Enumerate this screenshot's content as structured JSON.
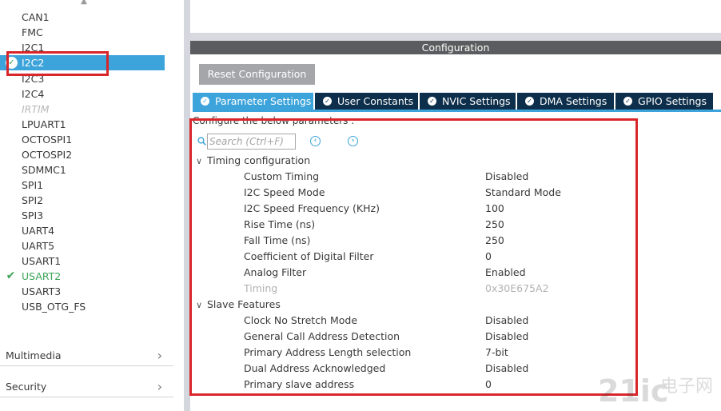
{
  "sidebar": {
    "items": [
      {
        "label": "CAN1",
        "state": "normal"
      },
      {
        "label": "FMC",
        "state": "normal"
      },
      {
        "label": "I2C1",
        "state": "normal"
      },
      {
        "label": "I2C2",
        "state": "selected"
      },
      {
        "label": "I2C3",
        "state": "normal"
      },
      {
        "label": "I2C4",
        "state": "normal"
      },
      {
        "label": "IRTIM",
        "state": "disabled"
      },
      {
        "label": "LPUART1",
        "state": "normal"
      },
      {
        "label": "OCTOSPI1",
        "state": "normal"
      },
      {
        "label": "OCTOSPI2",
        "state": "normal"
      },
      {
        "label": "SDMMC1",
        "state": "normal"
      },
      {
        "label": "SPI1",
        "state": "normal"
      },
      {
        "label": "SPI2",
        "state": "normal"
      },
      {
        "label": "SPI3",
        "state": "normal"
      },
      {
        "label": "UART4",
        "state": "normal"
      },
      {
        "label": "UART5",
        "state": "normal"
      },
      {
        "label": "USART1",
        "state": "normal"
      },
      {
        "label": "USART2",
        "state": "enabled"
      },
      {
        "label": "USART3",
        "state": "normal"
      },
      {
        "label": "USB_OTG_FS",
        "state": "normal"
      }
    ],
    "categories": [
      {
        "label": "Multimedia"
      },
      {
        "label": "Security"
      }
    ]
  },
  "config": {
    "header": "Configuration",
    "reset_button": "Reset Configuration",
    "tabs": [
      {
        "label": "Parameter Settings",
        "active": true
      },
      {
        "label": "User Constants",
        "active": false
      },
      {
        "label": "NVIC Settings",
        "active": false
      },
      {
        "label": "DMA Settings",
        "active": false
      },
      {
        "label": "GPIO Settings",
        "active": false
      }
    ],
    "instructions": "Configure the below parameters :",
    "search_placeholder": "Search (Ctrl+F)",
    "groups": [
      {
        "title": "Timing configuration",
        "params": [
          {
            "name": "Custom Timing",
            "value": "Disabled",
            "enabled": true
          },
          {
            "name": "I2C Speed Mode",
            "value": "Standard Mode",
            "enabled": true
          },
          {
            "name": "I2C Speed Frequency (KHz)",
            "value": "100",
            "enabled": true
          },
          {
            "name": "Rise Time (ns)",
            "value": "250",
            "enabled": true
          },
          {
            "name": "Fall Time (ns)",
            "value": "250",
            "enabled": true
          },
          {
            "name": "Coefficient of Digital Filter",
            "value": "0",
            "enabled": true
          },
          {
            "name": "Analog Filter",
            "value": "Enabled",
            "enabled": true
          },
          {
            "name": "Timing",
            "value": "0x30E675A2",
            "enabled": false
          }
        ]
      },
      {
        "title": "Slave Features",
        "params": [
          {
            "name": "Clock No Stretch Mode",
            "value": "Disabled",
            "enabled": true
          },
          {
            "name": "General Call Address Detection",
            "value": "Disabled",
            "enabled": true
          },
          {
            "name": "Primary Address Length selection",
            "value": "7-bit",
            "enabled": true
          },
          {
            "name": "Dual Address Acknowledged",
            "value": "Disabled",
            "enabled": true
          },
          {
            "name": "Primary slave address",
            "value": "0",
            "enabled": true
          }
        ]
      }
    ]
  },
  "watermark": {
    "brand": "21ic",
    "cn": "电子网"
  },
  "colors": {
    "selected_bg": "#3da4db",
    "enabled_green": "#3aa457",
    "tab_dark": "#0d2f4b",
    "header_gray": "#5b5c5f",
    "annotation_red": "#d8262b"
  }
}
